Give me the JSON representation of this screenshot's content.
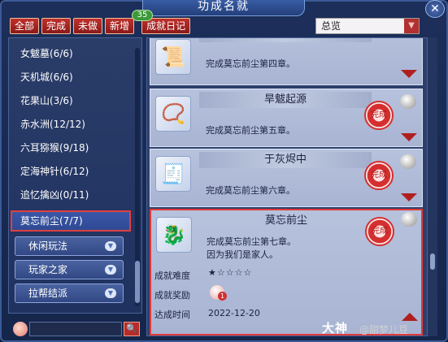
{
  "window": {
    "title": "功成名就",
    "close_label": "✕"
  },
  "filters": {
    "buttons": [
      "全部",
      "完成",
      "未做",
      "新增"
    ],
    "new_count": "35",
    "diary_label": "成就日记"
  },
  "dropdown": {
    "selected": "总览",
    "arrow": "▼"
  },
  "categories": [
    {
      "label": "女魃墓(6/6)"
    },
    {
      "label": "天机城(6/6)"
    },
    {
      "label": "花果山(3/6)"
    },
    {
      "label": "赤水洲(12/12)"
    },
    {
      "label": "六耳猕猴(9/18)"
    },
    {
      "label": "定海神针(6/12)"
    },
    {
      "label": "追忆擒凶(0/11)"
    },
    {
      "label": "莫忘前尘(7/7)"
    }
  ],
  "sub_groups": [
    {
      "label": "休闲玩法"
    },
    {
      "label": "玩家之家"
    },
    {
      "label": "拉帮结派"
    }
  ],
  "achievements": [
    {
      "title": "",
      "desc": "完成莫忘前尘第四章。",
      "icon": "📜"
    },
    {
      "title": "旱魃起源",
      "desc": "完成莫忘前尘第五章。",
      "icon": "📿"
    },
    {
      "title": "于灰烬中",
      "desc": "完成莫忘前尘第六章。",
      "icon": "🧾"
    },
    {
      "title": "莫忘前尘",
      "desc": "完成莫忘前尘第七章。",
      "desc2": "因为我们是家人。",
      "icon": "🐉",
      "difficulty_label": "成就难度",
      "difficulty": "★☆☆☆☆",
      "reward_label": "成就奖励",
      "reward_count": "1",
      "date_label": "达成时间",
      "date": "2022-12-20"
    }
  ],
  "seal_text": "完成",
  "icons": {
    "search": "search-icon",
    "close": "close-icon",
    "expand": "chevron-down-icon"
  },
  "colors": {
    "accent_red": "#b52d2a",
    "panel_blue": "#2d3f6b",
    "card_bg": "#b7c2dd"
  },
  "watermark": {
    "brand": "大神",
    "user": "@甜梦儿豆"
  }
}
